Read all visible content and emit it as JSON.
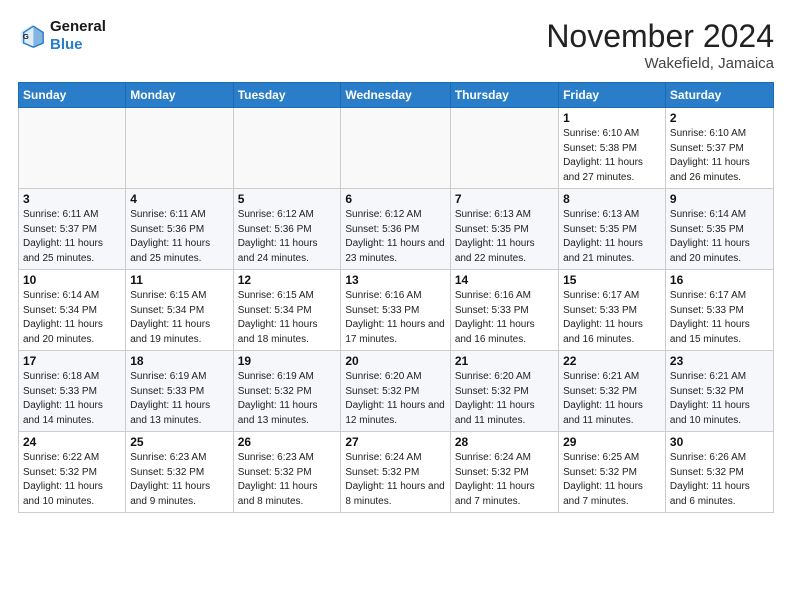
{
  "header": {
    "logo_line1": "General",
    "logo_line2": "Blue",
    "month": "November 2024",
    "location": "Wakefield, Jamaica"
  },
  "days_of_week": [
    "Sunday",
    "Monday",
    "Tuesday",
    "Wednesday",
    "Thursday",
    "Friday",
    "Saturday"
  ],
  "weeks": [
    [
      {
        "num": "",
        "info": ""
      },
      {
        "num": "",
        "info": ""
      },
      {
        "num": "",
        "info": ""
      },
      {
        "num": "",
        "info": ""
      },
      {
        "num": "",
        "info": ""
      },
      {
        "num": "1",
        "info": "Sunrise: 6:10 AM\nSunset: 5:38 PM\nDaylight: 11 hours and 27 minutes."
      },
      {
        "num": "2",
        "info": "Sunrise: 6:10 AM\nSunset: 5:37 PM\nDaylight: 11 hours and 26 minutes."
      }
    ],
    [
      {
        "num": "3",
        "info": "Sunrise: 6:11 AM\nSunset: 5:37 PM\nDaylight: 11 hours and 25 minutes."
      },
      {
        "num": "4",
        "info": "Sunrise: 6:11 AM\nSunset: 5:36 PM\nDaylight: 11 hours and 25 minutes."
      },
      {
        "num": "5",
        "info": "Sunrise: 6:12 AM\nSunset: 5:36 PM\nDaylight: 11 hours and 24 minutes."
      },
      {
        "num": "6",
        "info": "Sunrise: 6:12 AM\nSunset: 5:36 PM\nDaylight: 11 hours and 23 minutes."
      },
      {
        "num": "7",
        "info": "Sunrise: 6:13 AM\nSunset: 5:35 PM\nDaylight: 11 hours and 22 minutes."
      },
      {
        "num": "8",
        "info": "Sunrise: 6:13 AM\nSunset: 5:35 PM\nDaylight: 11 hours and 21 minutes."
      },
      {
        "num": "9",
        "info": "Sunrise: 6:14 AM\nSunset: 5:35 PM\nDaylight: 11 hours and 20 minutes."
      }
    ],
    [
      {
        "num": "10",
        "info": "Sunrise: 6:14 AM\nSunset: 5:34 PM\nDaylight: 11 hours and 20 minutes."
      },
      {
        "num": "11",
        "info": "Sunrise: 6:15 AM\nSunset: 5:34 PM\nDaylight: 11 hours and 19 minutes."
      },
      {
        "num": "12",
        "info": "Sunrise: 6:15 AM\nSunset: 5:34 PM\nDaylight: 11 hours and 18 minutes."
      },
      {
        "num": "13",
        "info": "Sunrise: 6:16 AM\nSunset: 5:33 PM\nDaylight: 11 hours and 17 minutes."
      },
      {
        "num": "14",
        "info": "Sunrise: 6:16 AM\nSunset: 5:33 PM\nDaylight: 11 hours and 16 minutes."
      },
      {
        "num": "15",
        "info": "Sunrise: 6:17 AM\nSunset: 5:33 PM\nDaylight: 11 hours and 16 minutes."
      },
      {
        "num": "16",
        "info": "Sunrise: 6:17 AM\nSunset: 5:33 PM\nDaylight: 11 hours and 15 minutes."
      }
    ],
    [
      {
        "num": "17",
        "info": "Sunrise: 6:18 AM\nSunset: 5:33 PM\nDaylight: 11 hours and 14 minutes."
      },
      {
        "num": "18",
        "info": "Sunrise: 6:19 AM\nSunset: 5:33 PM\nDaylight: 11 hours and 13 minutes."
      },
      {
        "num": "19",
        "info": "Sunrise: 6:19 AM\nSunset: 5:32 PM\nDaylight: 11 hours and 13 minutes."
      },
      {
        "num": "20",
        "info": "Sunrise: 6:20 AM\nSunset: 5:32 PM\nDaylight: 11 hours and 12 minutes."
      },
      {
        "num": "21",
        "info": "Sunrise: 6:20 AM\nSunset: 5:32 PM\nDaylight: 11 hours and 11 minutes."
      },
      {
        "num": "22",
        "info": "Sunrise: 6:21 AM\nSunset: 5:32 PM\nDaylight: 11 hours and 11 minutes."
      },
      {
        "num": "23",
        "info": "Sunrise: 6:21 AM\nSunset: 5:32 PM\nDaylight: 11 hours and 10 minutes."
      }
    ],
    [
      {
        "num": "24",
        "info": "Sunrise: 6:22 AM\nSunset: 5:32 PM\nDaylight: 11 hours and 10 minutes."
      },
      {
        "num": "25",
        "info": "Sunrise: 6:23 AM\nSunset: 5:32 PM\nDaylight: 11 hours and 9 minutes."
      },
      {
        "num": "26",
        "info": "Sunrise: 6:23 AM\nSunset: 5:32 PM\nDaylight: 11 hours and 8 minutes."
      },
      {
        "num": "27",
        "info": "Sunrise: 6:24 AM\nSunset: 5:32 PM\nDaylight: 11 hours and 8 minutes."
      },
      {
        "num": "28",
        "info": "Sunrise: 6:24 AM\nSunset: 5:32 PM\nDaylight: 11 hours and 7 minutes."
      },
      {
        "num": "29",
        "info": "Sunrise: 6:25 AM\nSunset: 5:32 PM\nDaylight: 11 hours and 7 minutes."
      },
      {
        "num": "30",
        "info": "Sunrise: 6:26 AM\nSunset: 5:32 PM\nDaylight: 11 hours and 6 minutes."
      }
    ]
  ]
}
